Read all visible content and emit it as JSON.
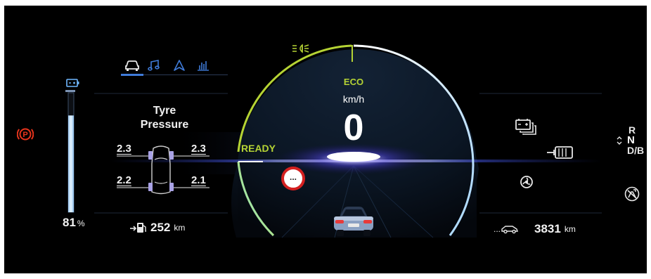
{
  "battery": {
    "percent_value": "81",
    "percent_unit": "%",
    "level": 0.81
  },
  "tabs": [
    {
      "icon": "car-icon",
      "active": true
    },
    {
      "icon": "music-icon",
      "active": false
    },
    {
      "icon": "navigation-icon",
      "active": false
    },
    {
      "icon": "bar-chart-icon",
      "active": false
    }
  ],
  "tyre": {
    "title_line1": "Tyre",
    "title_line2": "Pressure",
    "front_left": "2.3",
    "front_right": "2.3",
    "rear_left": "2.2",
    "rear_right": "2.1"
  },
  "range": {
    "value": "252",
    "unit": "km"
  },
  "speedometer": {
    "mode": "ECO",
    "unit": "km/h",
    "speed": "0",
    "status": "READY",
    "limit_sign": "...",
    "accent": "#b5d334"
  },
  "odometer": {
    "value": "3831",
    "unit": "km",
    "prefix": "..."
  },
  "gear": {
    "r": "R",
    "n": "N",
    "d": "D/B"
  },
  "colors": {
    "background": "#000000",
    "eco_green": "#b5d334",
    "parking_red": "#e8341c",
    "highlight_blue": "#3f7bd9"
  }
}
